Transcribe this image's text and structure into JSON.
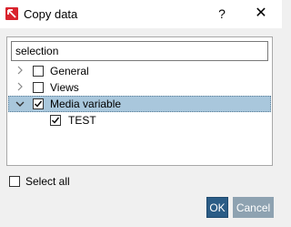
{
  "window": {
    "title": "Copy data",
    "help_label": "?",
    "close_label": "✕"
  },
  "search": {
    "value": "selection"
  },
  "tree": {
    "items": [
      {
        "label": "General",
        "checked": false,
        "expanded": false
      },
      {
        "label": "Views",
        "checked": false,
        "expanded": false
      },
      {
        "label": "Media variable",
        "checked": true,
        "expanded": true,
        "selected": true
      },
      {
        "label": "TEST",
        "checked": true,
        "child": true
      }
    ]
  },
  "footer": {
    "select_all_label": "Select all",
    "ok_label": "OK",
    "cancel_label": "Cancel"
  },
  "colors": {
    "selection": "#a9c7dc",
    "ok_button": "#2b5c86",
    "cancel_button": "#8ea2b1",
    "app_icon": "#d9232d"
  }
}
